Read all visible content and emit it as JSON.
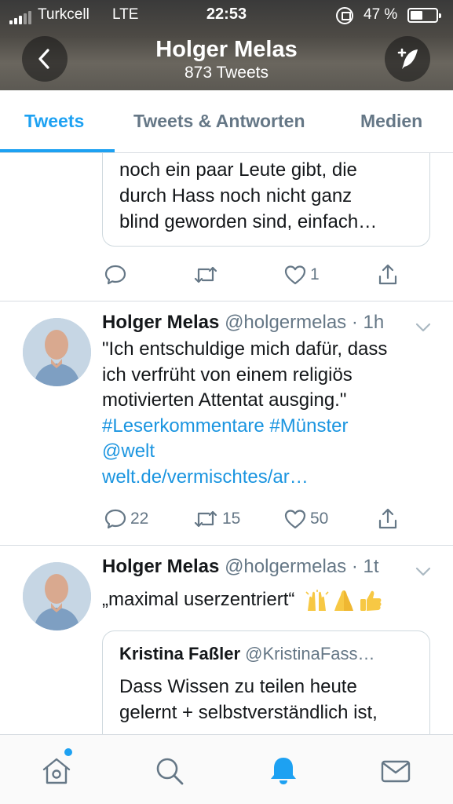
{
  "status_bar": {
    "carrier": "Turkcell",
    "network": "LTE",
    "time": "22:53",
    "battery": "47 %",
    "battery_level": 0.47
  },
  "header": {
    "name": "Holger Melas",
    "tweet_count": "873 Tweets",
    "back_icon": "chevron-left-icon",
    "compose_icon": "compose-feather-icon"
  },
  "tabs": [
    {
      "label": "Tweets",
      "active": true
    },
    {
      "label": "Tweets & Antworten",
      "active": false
    },
    {
      "label": "Medien",
      "active": false
    }
  ],
  "colors": {
    "accent": "#1da1f2",
    "link": "#1b95e0",
    "secondary_text": "#657786"
  },
  "feed": {
    "partial_quote": {
      "lines": [
        "noch ein paar Leute gibt, die",
        "durch Hass noch nicht ganz",
        "blind geworden sind, einfach…"
      ],
      "actions": {
        "reply": "",
        "retweet": "",
        "like": "1"
      }
    },
    "tweet1": {
      "name": "Holger Melas",
      "handle": "@holgermelas · 1h",
      "text_lines": [
        "\"Ich entschuldige mich dafür, dass",
        "ich verfrüht von einem religiös",
        "motivierten Attentat ausging.\""
      ],
      "links": [
        "#Leserkommentare #Münster",
        "@welt",
        "welt.de/vermischtes/ar…"
      ],
      "actions": {
        "reply": "22",
        "retweet": "15",
        "like": "50"
      }
    },
    "tweet2": {
      "name": "Holger Melas",
      "handle": "@holgermelas · 1t",
      "text": "„maximal userzentriert“",
      "emojis": [
        "raising-hands-emoji",
        "folded-hands-emoji",
        "thumbs-up-emoji"
      ],
      "quote": {
        "name": "Kristina Faßler",
        "handle": "@KristinaFass…",
        "lines": [
          "Dass Wissen zu teilen heute",
          "gelernt + selbstverständlich ist,"
        ]
      }
    }
  },
  "bottom_nav": [
    {
      "icon": "home-icon",
      "active": false,
      "has_badge": true
    },
    {
      "icon": "search-icon",
      "active": false
    },
    {
      "icon": "bell-icon",
      "active": true
    },
    {
      "icon": "mail-icon",
      "active": false
    }
  ]
}
